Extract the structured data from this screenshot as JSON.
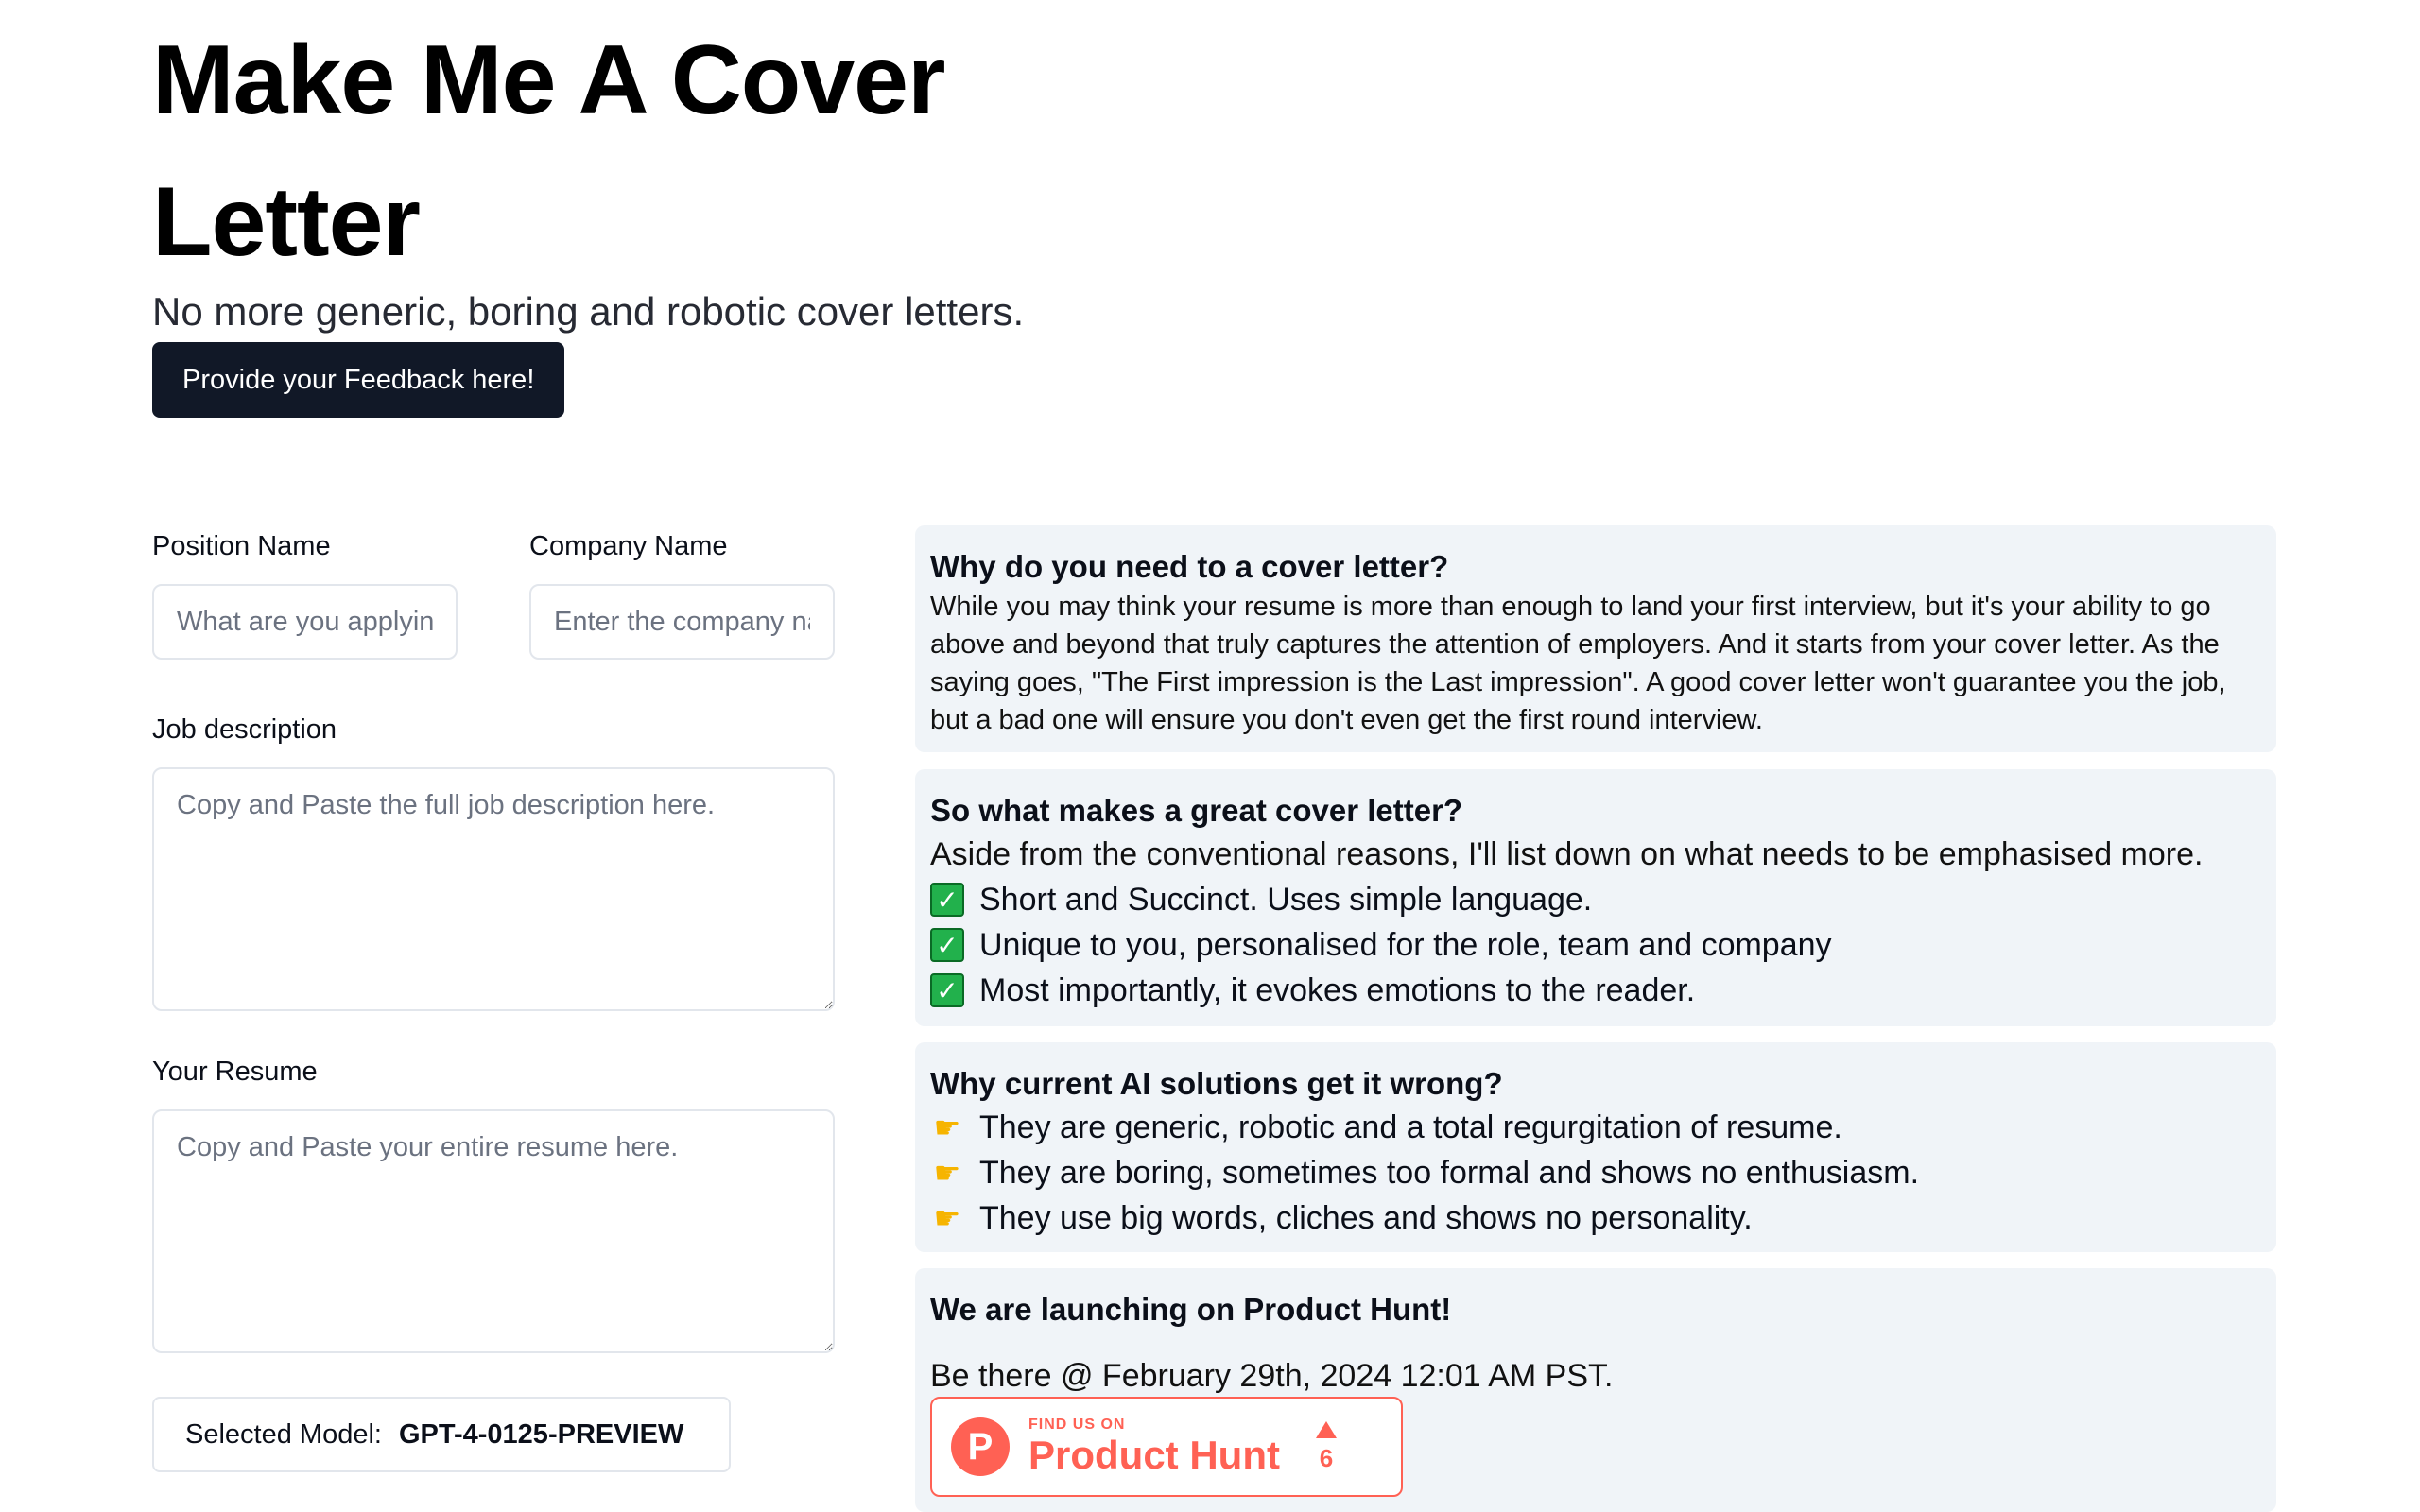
{
  "header": {
    "title": "Make Me A Cover Letter",
    "subtitle": "No more generic, boring and robotic cover letters.",
    "feedback_label": "Provide your Feedback here!"
  },
  "form": {
    "position_label": "Position Name",
    "position_placeholder": "What are you applying for?",
    "company_label": "Company Name",
    "company_placeholder": "Enter the company name",
    "job_label": "Job description",
    "job_placeholder": "Copy and Paste the full job description here.",
    "resume_label": "Your Resume",
    "resume_placeholder": "Copy and Paste your entire resume here.",
    "model_prefix": "Selected Model:",
    "model_name": "GPT-4-0125-PREVIEW"
  },
  "cards": {
    "why": {
      "heading": "Why do you need to a cover letter?",
      "body": "While you may think your resume is more than enough to land your first interview, but it's your ability to go above and beyond that truly captures the attention of employers. And it starts from your cover letter. As the saying goes, \"The First impression is the Last impression\". A good cover letter won't guarantee you the job, but a bad one will ensure you don't even get the first round interview."
    },
    "great": {
      "heading": "So what makes a great cover letter?",
      "intro": "Aside from the conventional reasons, I'll list down on what needs to be emphasised more.",
      "items": [
        "Short and Succinct. Uses simple language.",
        "Unique to you, personalised for the role, team and company",
        "Most importantly, it evokes emotions to the reader."
      ],
      "item_icon": "check-mark-icon"
    },
    "wrong": {
      "heading": "Why current AI solutions get it wrong?",
      "items": [
        "They are generic, robotic and a total regurgitation of resume.",
        "They are boring, sometimes too formal and shows no enthusiasm.",
        "They use big words, cliches and shows no personality."
      ],
      "item_icon": "pointing-hand-icon"
    },
    "launch": {
      "heading": "We are launching on Product Hunt!",
      "date_text": "Be there @ February 29th, 2024 12:01 AM PST.",
      "badge_small": "FIND US ON",
      "badge_big": "Product Hunt",
      "badge_logo": "P",
      "badge_count": "6",
      "badge_color": "#ff6154"
    }
  }
}
